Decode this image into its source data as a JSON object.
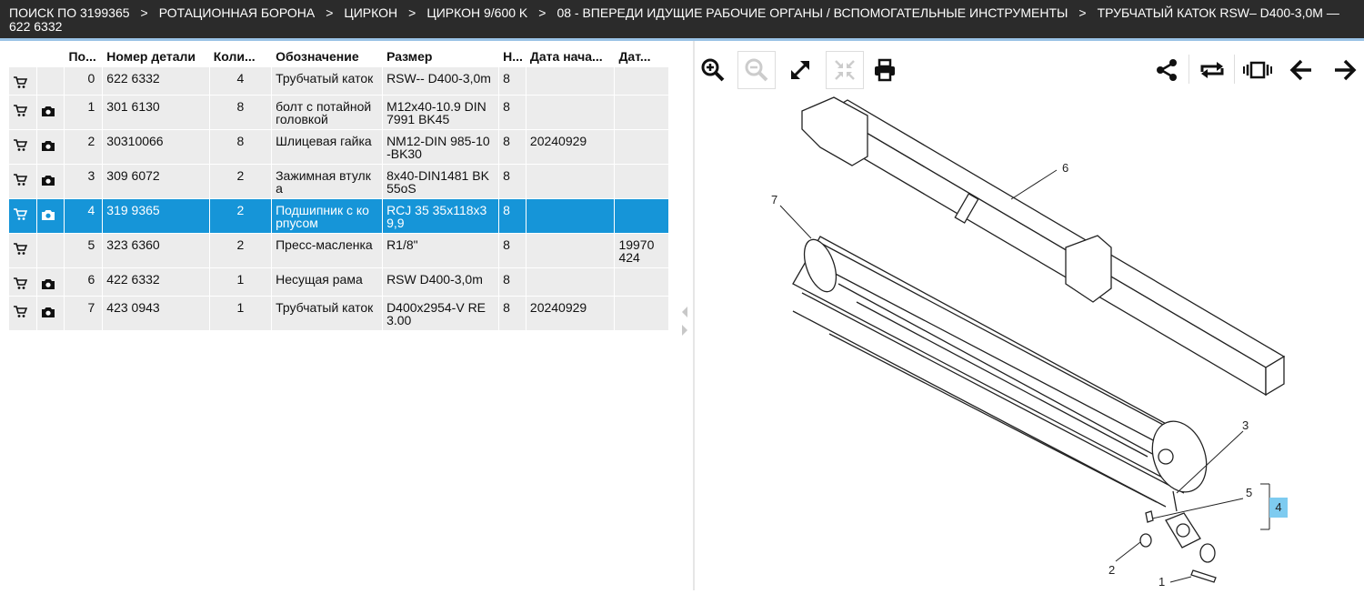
{
  "breadcrumb": [
    "ПОИСК ПО 3199365",
    "РОТАЦИОННАЯ БОРОНА",
    "ЦИРКОН",
    "ЦИРКОН 9/600 K",
    "08 - ВПЕРЕДИ ИДУЩИЕ РАБОЧИЕ ОРГАНЫ / ВСПОМОГАТЕЛЬНЫЕ ИНСТРУМЕНТЫ",
    "ТРУБЧАТЫЙ КАТОК RSW– D400-3,0M — 622 6332"
  ],
  "breadcrumb_separator": ">",
  "table": {
    "columns": [
      "По...",
      "Номер детали",
      "Коли...",
      "Обозначение",
      "Размер",
      "Н...",
      "Дата нача...",
      "Дат..."
    ],
    "rows": [
      {
        "pos": "0",
        "part": "622 6332",
        "qty": "4",
        "name": "Трубчатый каток",
        "size": "RSW-- D400-3,0m",
        "n": "8",
        "date_start": "",
        "date_end": "",
        "camera": false,
        "selected": false
      },
      {
        "pos": "1",
        "part": "301 6130",
        "qty": "8",
        "name": "болт с потайной головкой",
        "size": "M12x40-10.9 DIN 7991 BK45",
        "n": "8",
        "date_start": "",
        "date_end": "",
        "camera": true,
        "selected": false
      },
      {
        "pos": "2",
        "part": "30310066",
        "qty": "8",
        "name": "Шлицевая гайка",
        "size": "NM12-DIN 985-10 -BK30",
        "n": "8",
        "date_start": "20240929",
        "date_end": "",
        "camera": true,
        "selected": false
      },
      {
        "pos": "3",
        "part": "309 6072",
        "qty": "2",
        "name": "Зажимная втулк а",
        "size": "8x40-DIN1481 BK 55oS",
        "n": "8",
        "date_start": "",
        "date_end": "",
        "camera": true,
        "selected": false
      },
      {
        "pos": "4",
        "part": "319 9365",
        "qty": "2",
        "name": "Подшипник с ко рпусом",
        "size": "RCJ 35 35x118x3 9,9",
        "n": "8",
        "date_start": "",
        "date_end": "",
        "camera": true,
        "selected": true
      },
      {
        "pos": "5",
        "part": "323 6360",
        "qty": "2",
        "name": "Пресс-масленка",
        "size": "R1/8\"",
        "n": "8",
        "date_start": "",
        "date_end": "19970 424",
        "camera": false,
        "selected": false
      },
      {
        "pos": "6",
        "part": "422 6332",
        "qty": "1",
        "name": "Несущая рама",
        "size": "RSW D400-3,0m",
        "n": "8",
        "date_start": "",
        "date_end": "",
        "camera": true,
        "selected": false
      },
      {
        "pos": "7",
        "part": "423 0943",
        "qty": "1",
        "name": "Трубчатый каток",
        "size": "D400x2954-V RE 3.00",
        "n": "8",
        "date_start": "20240929",
        "date_end": "",
        "camera": true,
        "selected": false
      }
    ]
  },
  "toolbar": {
    "left": [
      "zoom-in-icon",
      "zoom-out-icon",
      "expand-icon",
      "fit-icon",
      "print-icon"
    ],
    "right": [
      "share-icon",
      "rotate-icon",
      "carousel-icon",
      "arrow-left-icon",
      "arrow-right-icon"
    ]
  },
  "callouts": [
    "7",
    "6",
    "3",
    "5",
    "4",
    "2",
    "1"
  ],
  "highlighted_callout": "4",
  "colors": {
    "topbar": "#2b2b2b",
    "selected_row": "#1695d8",
    "row": "#ececec",
    "highlight": "#7ecbf0"
  }
}
